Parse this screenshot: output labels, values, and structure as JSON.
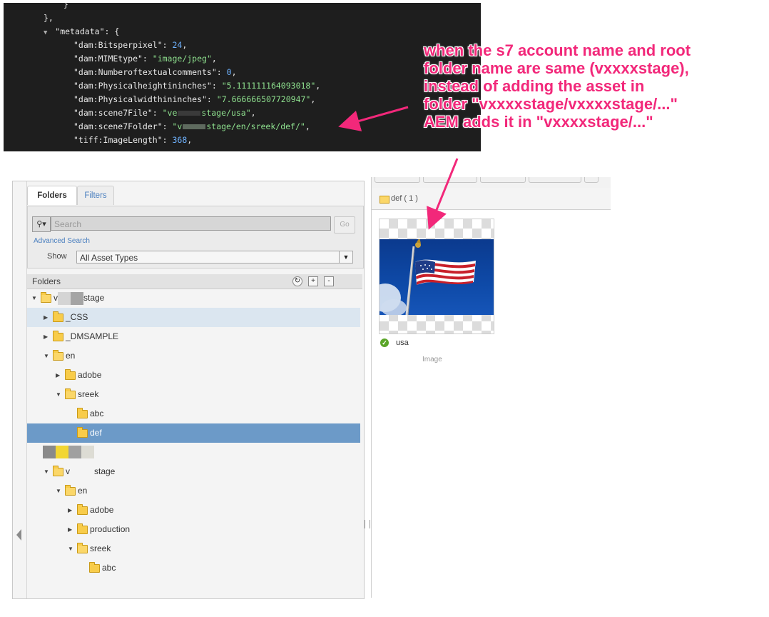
{
  "code": {
    "lines": [
      {
        "indent": 12,
        "tri": "",
        "parts": [
          [
            "k",
            "}"
          ]
        ]
      },
      {
        "indent": 8,
        "tri": "",
        "parts": [
          [
            "k",
            "},"
          ]
        ]
      },
      {
        "indent": 8,
        "tri": "▼",
        "parts": [
          [
            "k",
            "\"metadata\": {"
          ]
        ]
      },
      {
        "indent": 14,
        "tri": "",
        "parts": [
          [
            "k",
            "\"dam:Bitsperpixel\": "
          ],
          [
            "n",
            "24"
          ],
          [
            "k",
            ","
          ]
        ]
      },
      {
        "indent": 14,
        "tri": "",
        "parts": [
          [
            "k",
            "\"dam:MIMEtype\": "
          ],
          [
            "s",
            "\"image/jpeg\""
          ],
          [
            "k",
            ","
          ]
        ]
      },
      {
        "indent": 14,
        "tri": "",
        "parts": [
          [
            "k",
            "\"dam:Numberoftextualcomments\": "
          ],
          [
            "n",
            "0"
          ],
          [
            "k",
            ","
          ]
        ]
      },
      {
        "indent": 14,
        "tri": "",
        "parts": [
          [
            "k",
            "\"dam:Physicalheightininches\": "
          ],
          [
            "s",
            "\"5.111111164093018\""
          ],
          [
            "k",
            ","
          ]
        ]
      },
      {
        "indent": 14,
        "tri": "",
        "parts": [
          [
            "k",
            "\"dam:Physicalwidthininches\": "
          ],
          [
            "s",
            "\"7.666666507720947\""
          ],
          [
            "k",
            ","
          ]
        ]
      },
      {
        "indent": 14,
        "tri": "",
        "parts": [
          [
            "k",
            "\"dam:scene7File\": "
          ],
          [
            "s",
            "\"ve"
          ],
          [
            "blur",
            ""
          ],
          [
            "s",
            "stage/usa\""
          ],
          [
            "k",
            ","
          ]
        ]
      },
      {
        "indent": 14,
        "tri": "",
        "parts": [
          [
            "k",
            "\"dam:scene7Folder\": "
          ],
          [
            "s",
            "\"v"
          ],
          [
            "blurdark",
            ""
          ],
          [
            "s",
            "stage/en/sreek/def/\""
          ],
          [
            "k",
            ","
          ]
        ]
      },
      {
        "indent": 14,
        "tri": "",
        "parts": [
          [
            "k",
            "\"tiff:ImageLength\": "
          ],
          [
            "n",
            "368"
          ],
          [
            "k",
            ","
          ]
        ]
      }
    ]
  },
  "annotation": {
    "lines": [
      "when the s7 account name and root",
      "folder name are same (vxxxxstage),",
      "instead of adding the asset in",
      "folder \"vxxxxstage/vxxxxstage/...\"",
      "AEM adds it in \"vxxxxstage/...\""
    ],
    "color": "#f2287a"
  },
  "sidebar": {
    "tabs": {
      "folders": "Folders",
      "filters": "Filters"
    },
    "search": {
      "placeholder": "Search",
      "go": "Go",
      "advanced": "Advanced Search",
      "show_label": "Show",
      "asset_type": "All Asset Types"
    },
    "folders_title": "Folders",
    "tree": [
      {
        "label": "stage",
        "prefix": "v",
        "level": 0,
        "expanded": true,
        "state": "",
        "redacted": true
      },
      {
        "label": "_CSS",
        "level": 1,
        "expanded": false,
        "state": "hl"
      },
      {
        "label": "_DMSAMPLE",
        "level": 1,
        "expanded": false,
        "state": ""
      },
      {
        "label": "en",
        "level": 1,
        "expanded": true,
        "state": ""
      },
      {
        "label": "adobe",
        "level": 2,
        "expanded": false,
        "state": ""
      },
      {
        "label": "sreek",
        "level": 2,
        "expanded": true,
        "state": ""
      },
      {
        "label": "abc",
        "level": 3,
        "expanded": null,
        "state": ""
      },
      {
        "label": "def",
        "level": 3,
        "expanded": null,
        "state": "sel"
      },
      {
        "label": "",
        "level": 0,
        "expanded": null,
        "state": "pixels"
      },
      {
        "label": "stage",
        "prefix": "v",
        "level": 1,
        "expanded": true,
        "state": "",
        "redacted2": true
      },
      {
        "label": "en",
        "level": 2,
        "expanded": true,
        "state": ""
      },
      {
        "label": "adobe",
        "level": 3,
        "expanded": false,
        "state": ""
      },
      {
        "label": "production",
        "level": 3,
        "expanded": false,
        "state": ""
      },
      {
        "label": "sreek",
        "level": 3,
        "expanded": true,
        "state": ""
      },
      {
        "label": "abc",
        "level": 4,
        "expanded": null,
        "state": ""
      }
    ]
  },
  "content": {
    "breadcrumb": "def ( 1 )",
    "asset": {
      "name": "usa",
      "type": "Image"
    }
  }
}
